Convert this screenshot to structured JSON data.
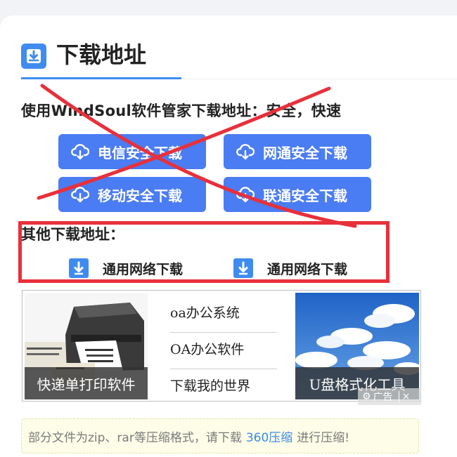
{
  "section": {
    "title": "下载地址",
    "subtitle": "使用WindSoul软件管家下载地址：安全，快速"
  },
  "download_buttons": [
    {
      "label": "电信安全下载"
    },
    {
      "label": "网通安全下载"
    },
    {
      "label": "移动安全下载"
    },
    {
      "label": "联通安全下载"
    }
  ],
  "other": {
    "title": "其他下载地址：",
    "links": [
      {
        "label": "通用网络下载"
      },
      {
        "label": "通用网络下载"
      }
    ]
  },
  "ad": {
    "left_caption": "快递单打印软件",
    "links": [
      "oa办公系统",
      "OA办公软件",
      "下载我的世界"
    ],
    "right_caption": "U盘格式化工具",
    "mark": "广告",
    "close": "×"
  },
  "notice": {
    "prefix": "部分文件为zip、rar等压缩格式，请下载",
    "link": "360压缩",
    "suffix": "进行压缩!"
  },
  "colors": {
    "accent": "#3f8cf0",
    "button": "#4a7cf3",
    "annotation_red": "#e8303a"
  }
}
